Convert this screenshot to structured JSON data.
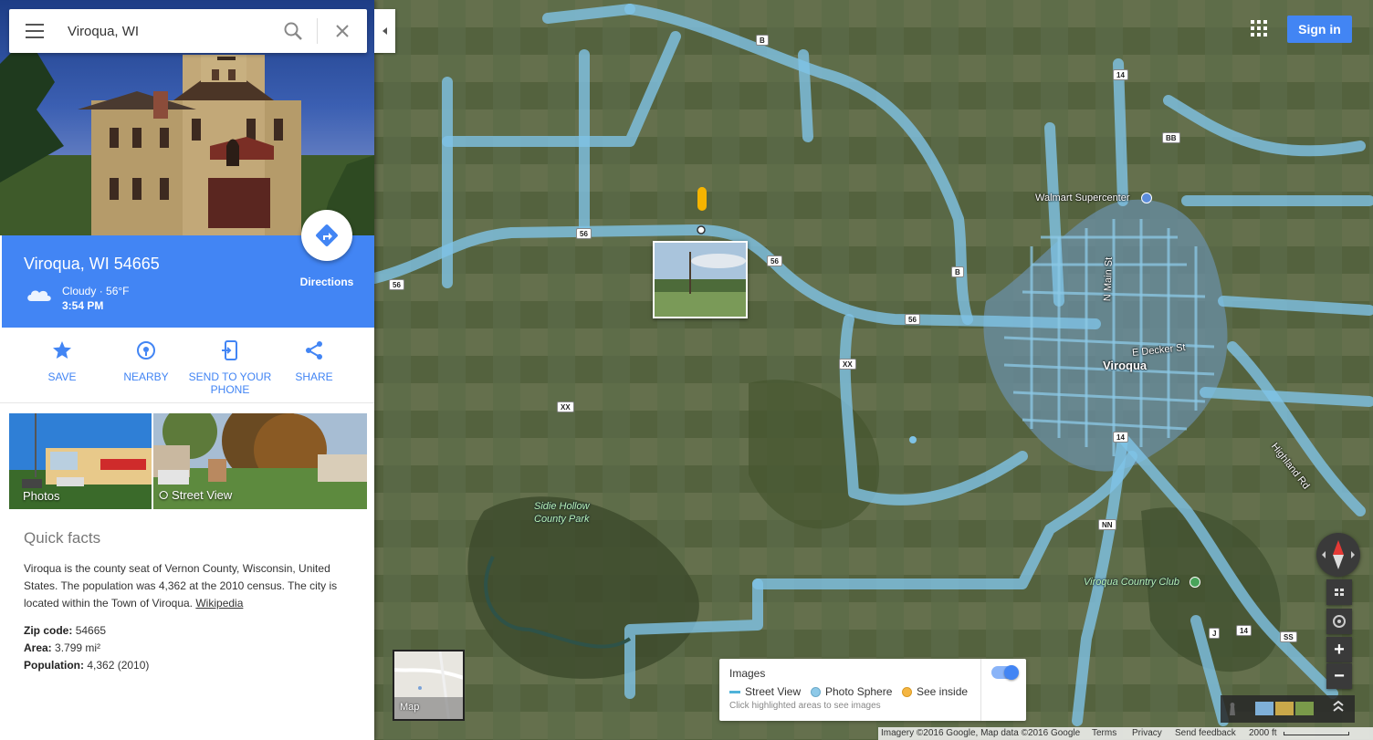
{
  "search": {
    "value": "Viroqua, WI"
  },
  "place": {
    "title": "Viroqua, WI 54665",
    "weather_line": "Cloudy · 56°F",
    "time": "3:54 PM",
    "directions_label": "Directions"
  },
  "actions": [
    {
      "label": "SAVE",
      "icon": "star-icon"
    },
    {
      "label": "NEARBY",
      "icon": "nearby-icon"
    },
    {
      "label": "SEND TO YOUR PHONE",
      "icon": "send-to-phone-icon"
    },
    {
      "label": "SHARE",
      "icon": "share-icon"
    }
  ],
  "thumbs": {
    "photos": "Photos",
    "street_view": "Street View"
  },
  "facts": {
    "title": "Quick facts",
    "body": "Viroqua is the county seat of Vernon County, Wisconsin, United States. The population was 4,362 at the 2010 census. The city is located within the Town of Viroqua.",
    "link": "Wikipedia",
    "rows": [
      {
        "key": "Zip code:",
        "value": "54665"
      },
      {
        "key": "Area:",
        "value": "3.799 mi²"
      },
      {
        "key": "Population:",
        "value": "4,362 (2010)"
      }
    ]
  },
  "header": {
    "signin": "Sign in"
  },
  "map": {
    "labels": {
      "walmart": "Walmart Supercenter",
      "viroqua": "Viroqua",
      "decker": "E Decker St",
      "nmain": "N Main St",
      "highland": "Highland Rd",
      "sidie1": "Sidie Hollow",
      "sidie2": "County Park",
      "club": "Viroqua Country Club"
    },
    "shields": [
      "B",
      "14",
      "BB",
      "56",
      "56",
      "56",
      "B",
      "56",
      "XX",
      "XX",
      "14",
      "NN",
      "J",
      "14",
      "SS"
    ]
  },
  "minimap": {
    "label": "Map"
  },
  "images_card": {
    "title": "Images",
    "street_view": "Street View",
    "photo_sphere": "Photo Sphere",
    "see_inside": "See inside",
    "hint": "Click highlighted areas to see images",
    "toggle_on": true
  },
  "footer": {
    "attribution": "Imagery ©2016 Google, Map data ©2016 Google",
    "terms": "Terms",
    "privacy": "Privacy",
    "feedback": "Send feedback",
    "scale": "2000 ft"
  },
  "colors": {
    "accent": "#4285f4",
    "streetview_overlay": "#7fc3e6",
    "photo_sphere": "#8ec9e8",
    "see_inside": "#f5b642"
  }
}
